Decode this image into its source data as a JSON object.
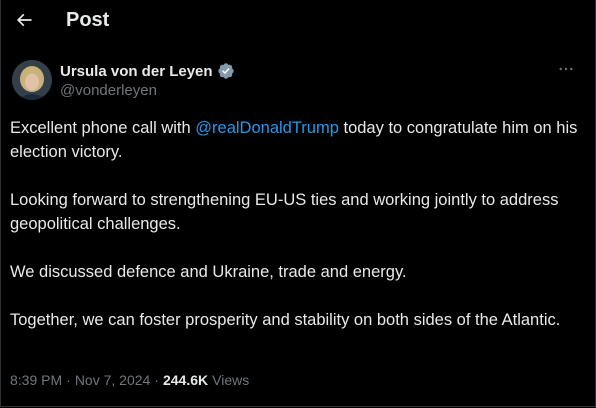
{
  "header": {
    "title": "Post",
    "back_icon": "arrow-left-icon"
  },
  "author": {
    "display_name": "Ursula von der Leyen",
    "handle": "@vonderleyen",
    "verified_icon": "verified-badge-icon",
    "verified_color": "#829aab"
  },
  "more_icon": "more-horizontal-icon",
  "tweet": {
    "p1_before": "Excellent phone call with ",
    "p1_mention": "@realDonaldTrump",
    "p1_after": " today to congratulate him on his election victory.",
    "p2": "Looking forward to strengthening EU-US ties and working jointly to address geopolitical challenges.",
    "p3": "We discussed defence and Ukraine, trade and energy.",
    "p4": "Together, we can foster prosperity and stability on both sides of the Atlantic."
  },
  "meta": {
    "time": "8:39 PM",
    "separator": "·",
    "date": "Nov 7, 2024",
    "views_count": "244.6K",
    "views_label": "Views"
  },
  "colors": {
    "background": "#000000",
    "text": "#e7e9ea",
    "secondary": "#71767b",
    "link": "#1d9bf0"
  }
}
